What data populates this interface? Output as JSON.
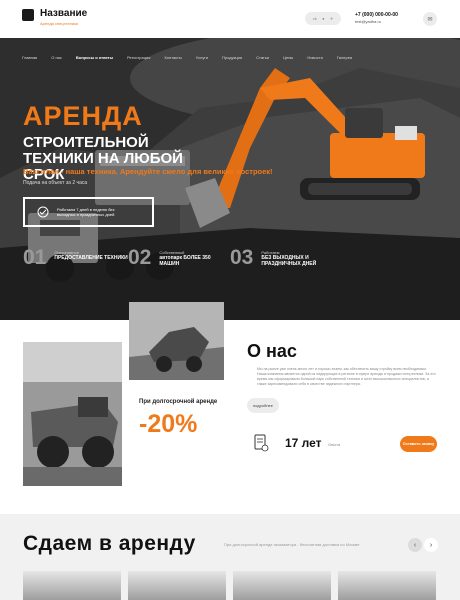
{
  "header": {
    "logo_title": "Название",
    "logo_subtitle": "Аренда спецтехники",
    "social": [
      "vk",
      "ok",
      "tg"
    ],
    "phone": "+7 (000) 000-00-00",
    "email": "test@yadha.ru",
    "mail_icon": "mail-icon"
  },
  "nav": {
    "items": [
      "Главная",
      "О нас",
      "Вопросы и ответы",
      "Регистрация",
      "Контакты",
      "Услуги",
      "Продукция",
      "Статьи",
      "Цены",
      "Новости",
      "Галерея"
    ],
    "active_index": 2
  },
  "hero": {
    "title_orange": "АРЕНДА",
    "title_white": "СТРОИТЕЛЬНОЙ ТЕХНИКИ НА ЛЮБОЙ СРОК",
    "tagline": "Ваш план - наша техника. Арендуйте смело для великих построек!",
    "note": "Подача на объект за 2 часа",
    "card_text": "Работаем 7 дней в неделю без выходных и праздничных дней",
    "stats": [
      {
        "num": "01",
        "label_line1": "Оперативное",
        "label_line2": "ПРЕДОСТАВЛЕНИЕ ТЕХНИКИ"
      },
      {
        "num": "02",
        "label_line1": "Собственный",
        "label_line2": "автопарк БОЛЕЕ 350 МАШИН"
      },
      {
        "num": "03",
        "label_line1": "Работаем",
        "label_line2": "БЕЗ ВЫХОДНЫХ И ПРАЗДНИЧНЫХ ДНЕЙ"
      }
    ]
  },
  "about": {
    "promo_label": "При долгосрочной аренде",
    "promo_value": "-20%",
    "title": "О нас",
    "text": "Мы на рынке уже очень много лет и хорошо знаем, как обеспечить вашу стройку всем необходимым. Наша компания является одной из лидирующих в регионе в сфере аренды и продажи спецтехники. За это время мы сформировали большой парк собственной техники и штат высококлассных специалистов, а также зарекомендовали себя в качестве надежного партнера.",
    "more_button": "подробнее",
    "years_value": "17 лет",
    "years_label": "Опыта",
    "contact_button": "Оставить заявку"
  },
  "rent": {
    "title": "Сдаем в аренду",
    "description": "При долгосрочной аренде экскаватора - бесплатная доставка по Москве",
    "prev_icon": "chevron-left-icon",
    "next_icon": "chevron-right-icon"
  },
  "colors": {
    "accent": "#f07a1a",
    "dark": "#1a1a1a"
  }
}
